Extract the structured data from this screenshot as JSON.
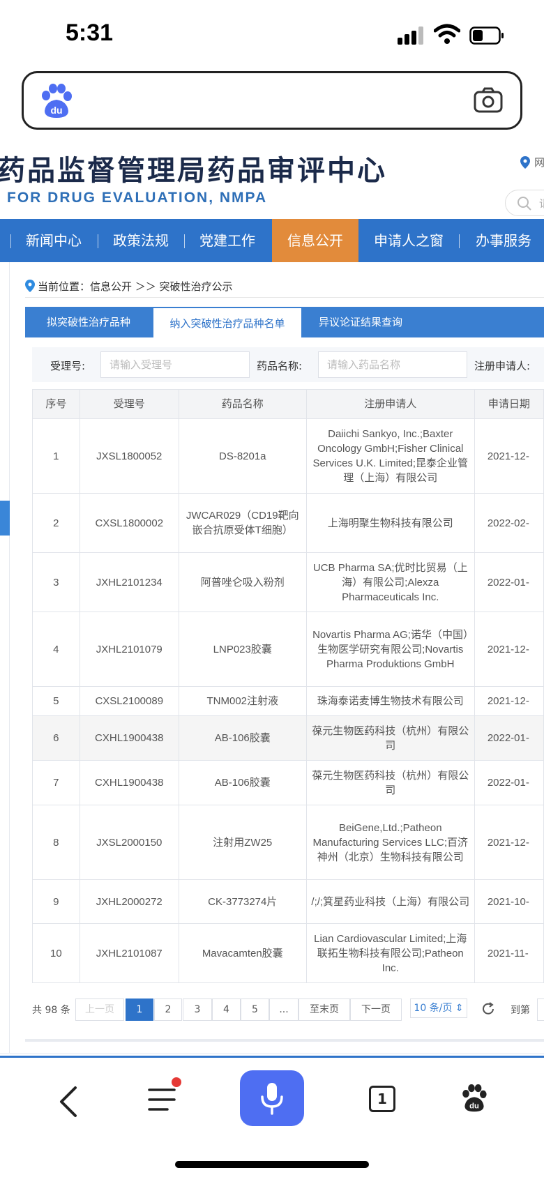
{
  "status_bar": {
    "time": "5:31"
  },
  "site": {
    "title_cn": "药品监督管理局药品审评中心",
    "title_en": "FOR DRUG EVALUATION, NMPA",
    "header_link": "网",
    "search_placeholder": "请"
  },
  "nav": {
    "items": [
      {
        "label": "新闻中心"
      },
      {
        "label": "政策法规"
      },
      {
        "label": "党建工作"
      },
      {
        "label": "信息公开",
        "active": true
      },
      {
        "label": "申请人之窗"
      },
      {
        "label": "办事服务"
      }
    ]
  },
  "breadcrumb": {
    "text": "当前位置：信息公开 ＞＞ 突破性治疗公示"
  },
  "tabs": [
    {
      "label": "拟突破性治疗品种"
    },
    {
      "label": "纳入突破性治疗品种名单",
      "active": true
    },
    {
      "label": "异议论证结果查询"
    }
  ],
  "filters": {
    "acceptance_label": "受理号:",
    "acceptance_placeholder": "请输入受理号",
    "drug_label": "药品名称:",
    "drug_placeholder": "请输入药品名称",
    "applicant_label": "注册申请人:"
  },
  "table": {
    "headers": [
      "序号",
      "受理号",
      "药品名称",
      "注册申请人",
      "申请日期"
    ],
    "rows": [
      {
        "no": "1",
        "acc": "JXSL1800052",
        "drug": "DS-8201a",
        "applicant": "Daiichi Sankyo, Inc.;Baxter Oncology GmbH;Fisher Clinical Services U.K. Limited;昆泰企业管理（上海）有限公司",
        "date": "2021-12-"
      },
      {
        "no": "2",
        "acc": "CXSL1800002",
        "drug": "JWCAR029（CD19靶向嵌合抗原受体T细胞）",
        "applicant": "上海明聚生物科技有限公司",
        "date": "2022-02-"
      },
      {
        "no": "3",
        "acc": "JXHL2101234",
        "drug": "阿普唑仑吸入粉剂",
        "applicant": "UCB Pharma SA;优时比贸易（上海）有限公司;Alexza Pharmaceuticals Inc.",
        "date": "2022-01-"
      },
      {
        "no": "4",
        "acc": "JXHL2101079",
        "drug": "LNP023胶囊",
        "applicant": "Novartis Pharma AG;诺华（中国）生物医学研究有限公司;Novartis Pharma Produktions GmbH",
        "date": "2021-12-"
      },
      {
        "no": "5",
        "acc": "CXSL2100089",
        "drug": "TNM002注射液",
        "applicant": "珠海泰诺麦博生物技术有限公司",
        "date": "2021-12-"
      },
      {
        "no": "6",
        "acc": "CXHL1900438",
        "drug": "AB-106胶囊",
        "applicant": "葆元生物医药科技（杭州）有限公司",
        "date": "2022-01-"
      },
      {
        "no": "7",
        "acc": "CXHL1900438",
        "drug": "AB-106胶囊",
        "applicant": "葆元生物医药科技（杭州）有限公司",
        "date": "2022-01-"
      },
      {
        "no": "8",
        "acc": "JXSL2000150",
        "drug": "注射用ZW25",
        "applicant": "BeiGene,Ltd.;Patheon Manufacturing Services LLC;百济神州（北京）生物科技有限公司",
        "date": "2021-12-"
      },
      {
        "no": "9",
        "acc": "JXHL2000272",
        "drug": "CK-3773274片",
        "applicant": "/;/;箕星药业科技（上海）有限公司",
        "date": "2021-10-"
      },
      {
        "no": "10",
        "acc": "JXHL2101087",
        "drug": "Mavacamten胶囊",
        "applicant": "Lian Cardiovascular Limited;上海联拓生物科技有限公司;Patheon Inc.",
        "date": "2021-11-"
      }
    ]
  },
  "pager": {
    "total": "共 98 条",
    "prev": "上一页",
    "pages": [
      "1",
      "2",
      "3",
      "4",
      "5",
      "..."
    ],
    "last": "至末页",
    "next": "下一页",
    "per_page": "10 条/页",
    "goto": "到第"
  },
  "bottom_bar": {
    "tab_count": "1"
  },
  "colors": {
    "brand_blue": "#2e73c9",
    "nav_active": "#e28b3b",
    "baidu_blue": "#4e6ef2",
    "badge_red": "#e53935"
  }
}
